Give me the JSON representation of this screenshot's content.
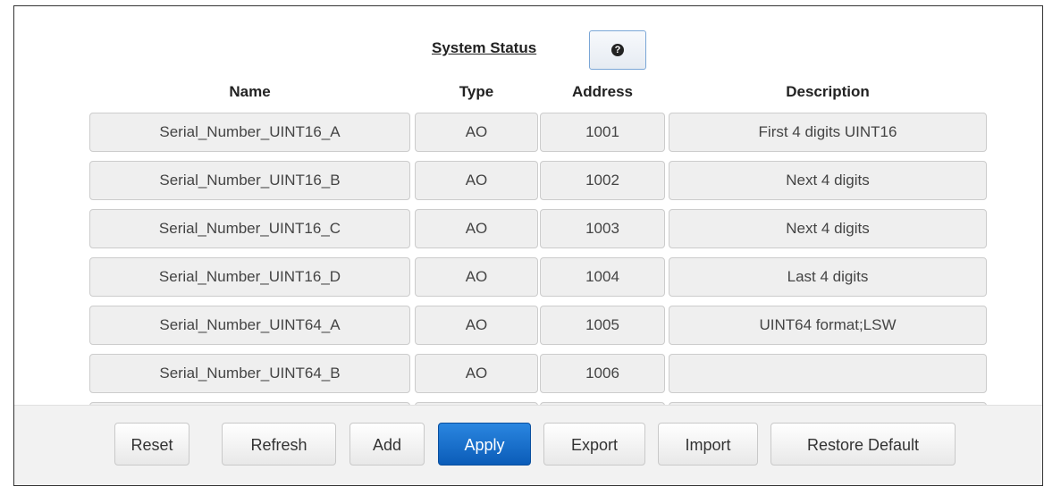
{
  "header": {
    "title": "System Status",
    "help_icon_glyph": "?"
  },
  "columns": {
    "name": "Name",
    "type": "Type",
    "address": "Address",
    "description": "Description"
  },
  "rows": [
    {
      "name": "Serial_Number_UINT16_A",
      "type": "AO",
      "address": "1001",
      "description": "First 4 digits UINT16"
    },
    {
      "name": "Serial_Number_UINT16_B",
      "type": "AO",
      "address": "1002",
      "description": "Next 4 digits"
    },
    {
      "name": "Serial_Number_UINT16_C",
      "type": "AO",
      "address": "1003",
      "description": "Next 4 digits"
    },
    {
      "name": "Serial_Number_UINT16_D",
      "type": "AO",
      "address": "1004",
      "description": "Last 4 digits"
    },
    {
      "name": "Serial_Number_UINT64_A",
      "type": "AO",
      "address": "1005",
      "description": "UINT64 format;LSW"
    },
    {
      "name": "Serial_Number_UINT64_B",
      "type": "AO",
      "address": "1006",
      "description": ""
    },
    {
      "name": "",
      "type": "",
      "address": "",
      "description": ""
    }
  ],
  "footer": {
    "reset": "Reset",
    "refresh": "Refresh",
    "add": "Add",
    "apply": "Apply",
    "export": "Export",
    "import": "Import",
    "restore_default": "Restore Default"
  },
  "colors": {
    "primary": "#0b5cb8",
    "cell_bg": "#efefef",
    "footer_bg": "#f2f2f2"
  }
}
